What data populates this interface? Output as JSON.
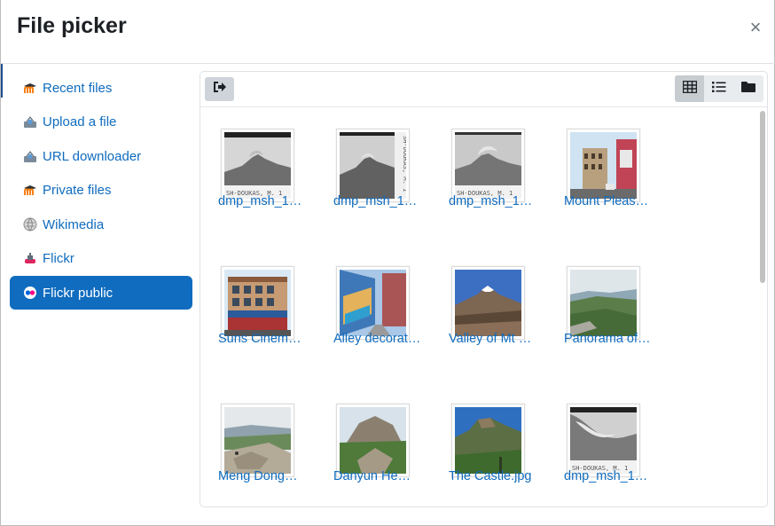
{
  "dialog": {
    "title": "File picker",
    "close_glyph": "×"
  },
  "sidebar": {
    "items": [
      {
        "label": "Recent files",
        "icon": "moodle-icon"
      },
      {
        "label": "Upload a file",
        "icon": "upload-icon"
      },
      {
        "label": "URL downloader",
        "icon": "url-download-icon"
      },
      {
        "label": "Private files",
        "icon": "moodle-icon"
      },
      {
        "label": "Wikimedia",
        "icon": "wikimedia-icon"
      },
      {
        "label": "Flickr",
        "icon": "flickr-icon"
      },
      {
        "label": "Flickr public",
        "icon": "flickr-public-icon",
        "active": true
      }
    ]
  },
  "toolbar": {
    "logout_icon": "logout-icon",
    "views": [
      {
        "name": "icons-view",
        "icon": "grid-icon",
        "active": true
      },
      {
        "name": "list-view",
        "icon": "list-icon"
      },
      {
        "name": "tree-view",
        "icon": "folder-icon"
      }
    ]
  },
  "files": [
    {
      "name": "dmp_msh_1…",
      "thumb": "bw-volcano"
    },
    {
      "name": "dmp_msh_1…",
      "thumb": "bw-volcano"
    },
    {
      "name": "dmp_msh_1…",
      "thumb": "bw-volcano"
    },
    {
      "name": "Mount Pleas…",
      "thumb": "street"
    },
    {
      "name": "Suns Cinem…",
      "thumb": "building"
    },
    {
      "name": "Alley decorat…",
      "thumb": "alley"
    },
    {
      "name": "Valley of Mt …",
      "thumb": "snow-mountain"
    },
    {
      "name": "Panorama of…",
      "thumb": "green-hills"
    },
    {
      "name": "Meng Dong…",
      "thumb": "rocky-summit"
    },
    {
      "name": "Danyun He…",
      "thumb": "rock-peak"
    },
    {
      "name": "The Castle.jpg",
      "thumb": "castle-mountain"
    },
    {
      "name": "dmp_msh_1…",
      "thumb": "bw-cloud"
    }
  ],
  "colors": {
    "link": "#0f6cbf",
    "active_bg": "#0f6cbf",
    "heading": "#1d2125"
  }
}
